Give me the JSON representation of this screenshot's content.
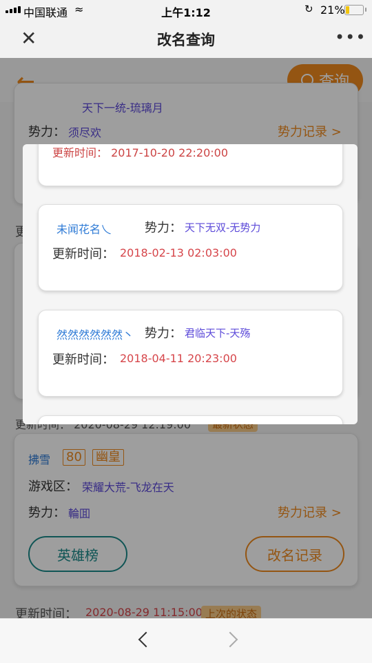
{
  "status": {
    "carrier": "中国联通",
    "time": "上午1:12",
    "battery": "21%"
  },
  "nav": {
    "title": "改名查询"
  },
  "header": {
    "search_label": "查询"
  },
  "top_card": {
    "zone_value": "天下一统-琉璃月",
    "power_label": "势力：",
    "power_value": "须尽欢",
    "power_record": "势力记录 >"
  },
  "side_texts": {
    "update_prefix": "更",
    "update_time_partial": "更新时间：  2020-08-29 12:19:00",
    "status_latest": "最新状态"
  },
  "player_card": {
    "name": "拂雪",
    "level": "80",
    "class": "幽皇",
    "zone_label": "游戏区：",
    "zone_value": "荣耀大荒-飞龙在天",
    "power_label": "势力：",
    "power_value": "輪囬",
    "power_record": "势力记录 >",
    "hero_button": "英雄榜",
    "rename_button": "改名记录"
  },
  "footer_line": {
    "label": "更新时间：",
    "time": "2020-08-29 11:15:00",
    "status": "上次的状态"
  },
  "modal": {
    "top_partial": "更新时间：  2017-10-20 22:20:00",
    "records": [
      {
        "name": "未闻花名乀",
        "power_label": "势力：",
        "power_value": "天下无双-无势力",
        "time_label": "更新时间：",
        "time": "2018-02-13 02:03:00"
      },
      {
        "name": "然然然然然然丶",
        "power_label": "势力：",
        "power_value": "君临天下-天殇",
        "time_label": "更新时间：",
        "time": "2018-04-11 20:23:00"
      }
    ]
  },
  "colors": {
    "accent": "#ef8a1e",
    "name_blue": "#2f7bd6",
    "value_purple": "#5c4ad9",
    "time_red": "#d6454a",
    "teal": "#1a8a8a"
  }
}
